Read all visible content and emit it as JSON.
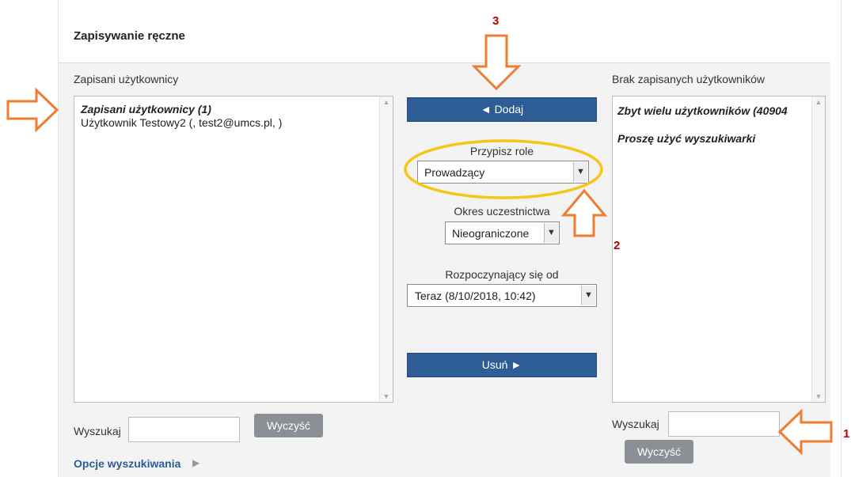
{
  "header": {
    "title": "Zapisywanie ręczne"
  },
  "left": {
    "label": "Zapisani użytkownicy",
    "group_label": "Zapisani użytkownicy (1)",
    "items": [
      "Użytkownik Testowy2 (, test2@umcs.pl, )"
    ],
    "search_label": "Wyszukaj",
    "search_value": "",
    "clear_label": "Wyczyść",
    "options_link": "Opcje wyszukiwania"
  },
  "center": {
    "add_label": "◄ Dodaj",
    "role_label": "Przypisz role",
    "role_value": "Prowadzący",
    "duration_label": "Okres uczestnictwa",
    "duration_value": "Nieograniczone",
    "start_label": "Rozpoczynający się od",
    "start_value": "Teraz (8/10/2018, 10:42)",
    "remove_label": "Usuń ►"
  },
  "right": {
    "label": "Brak zapisanych użytkowników",
    "line1": "Zbyt wielu użytkowników (40904",
    "line2": "Proszę użyć wyszukiwarki",
    "search_label": "Wyszukaj",
    "search_value": "",
    "clear_label": "Wyczyść"
  },
  "annotations": {
    "n1": "1",
    "n2": "2",
    "n3": "3"
  },
  "colors": {
    "button_blue": "#2e5c95",
    "annotation_orange": "#ed7d31",
    "highlight_yellow": "#f5c518",
    "number_red": "#c00000"
  }
}
